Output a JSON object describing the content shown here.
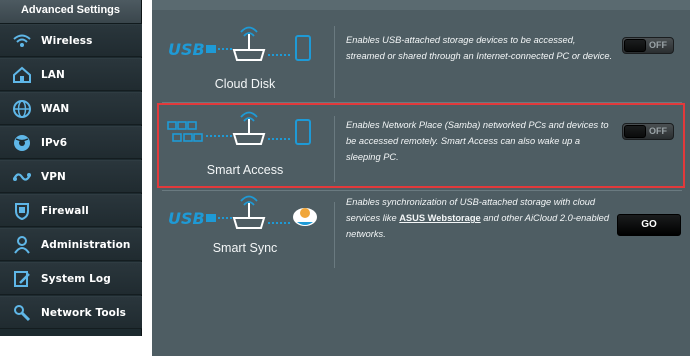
{
  "sidebar": {
    "title": "Advanced Settings",
    "items": [
      {
        "label": "Wireless",
        "icon": "wifi-icon"
      },
      {
        "label": "LAN",
        "icon": "home-icon"
      },
      {
        "label": "WAN",
        "icon": "globe-icon"
      },
      {
        "label": "IPv6",
        "icon": "ipv6-globe-icon"
      },
      {
        "label": "VPN",
        "icon": "vpn-icon"
      },
      {
        "label": "Firewall",
        "icon": "shield-icon"
      },
      {
        "label": "Administration",
        "icon": "user-icon"
      },
      {
        "label": "System Log",
        "icon": "log-icon"
      },
      {
        "label": "Network Tools",
        "icon": "tools-icon"
      }
    ]
  },
  "features": [
    {
      "name": "Cloud Disk",
      "description": "Enables USB-attached storage devices to be accessed, streamed or shared through an Internet-connected PC or device.",
      "toggle": "OFF"
    },
    {
      "name": "Smart Access",
      "description": "Enables Network Place (Samba) networked PCs and devices to be accessed remotely. Smart Access can also wake up a sleeping PC.",
      "toggle": "OFF"
    },
    {
      "name": "Smart Sync",
      "description_pre": "Enables synchronization of USB-attached storage with cloud services like ",
      "description_link": "ASUS Webstorage",
      "description_post": " and other AiCloud 2.0-enabled networks.",
      "button": "GO"
    }
  ],
  "graphics": {
    "usb_label": "USB",
    "accent": "#1e9ad6"
  },
  "colors": {
    "highlight": "#e2393b",
    "panel": "#4e5d63",
    "sidebar": "#1d2a2f"
  }
}
